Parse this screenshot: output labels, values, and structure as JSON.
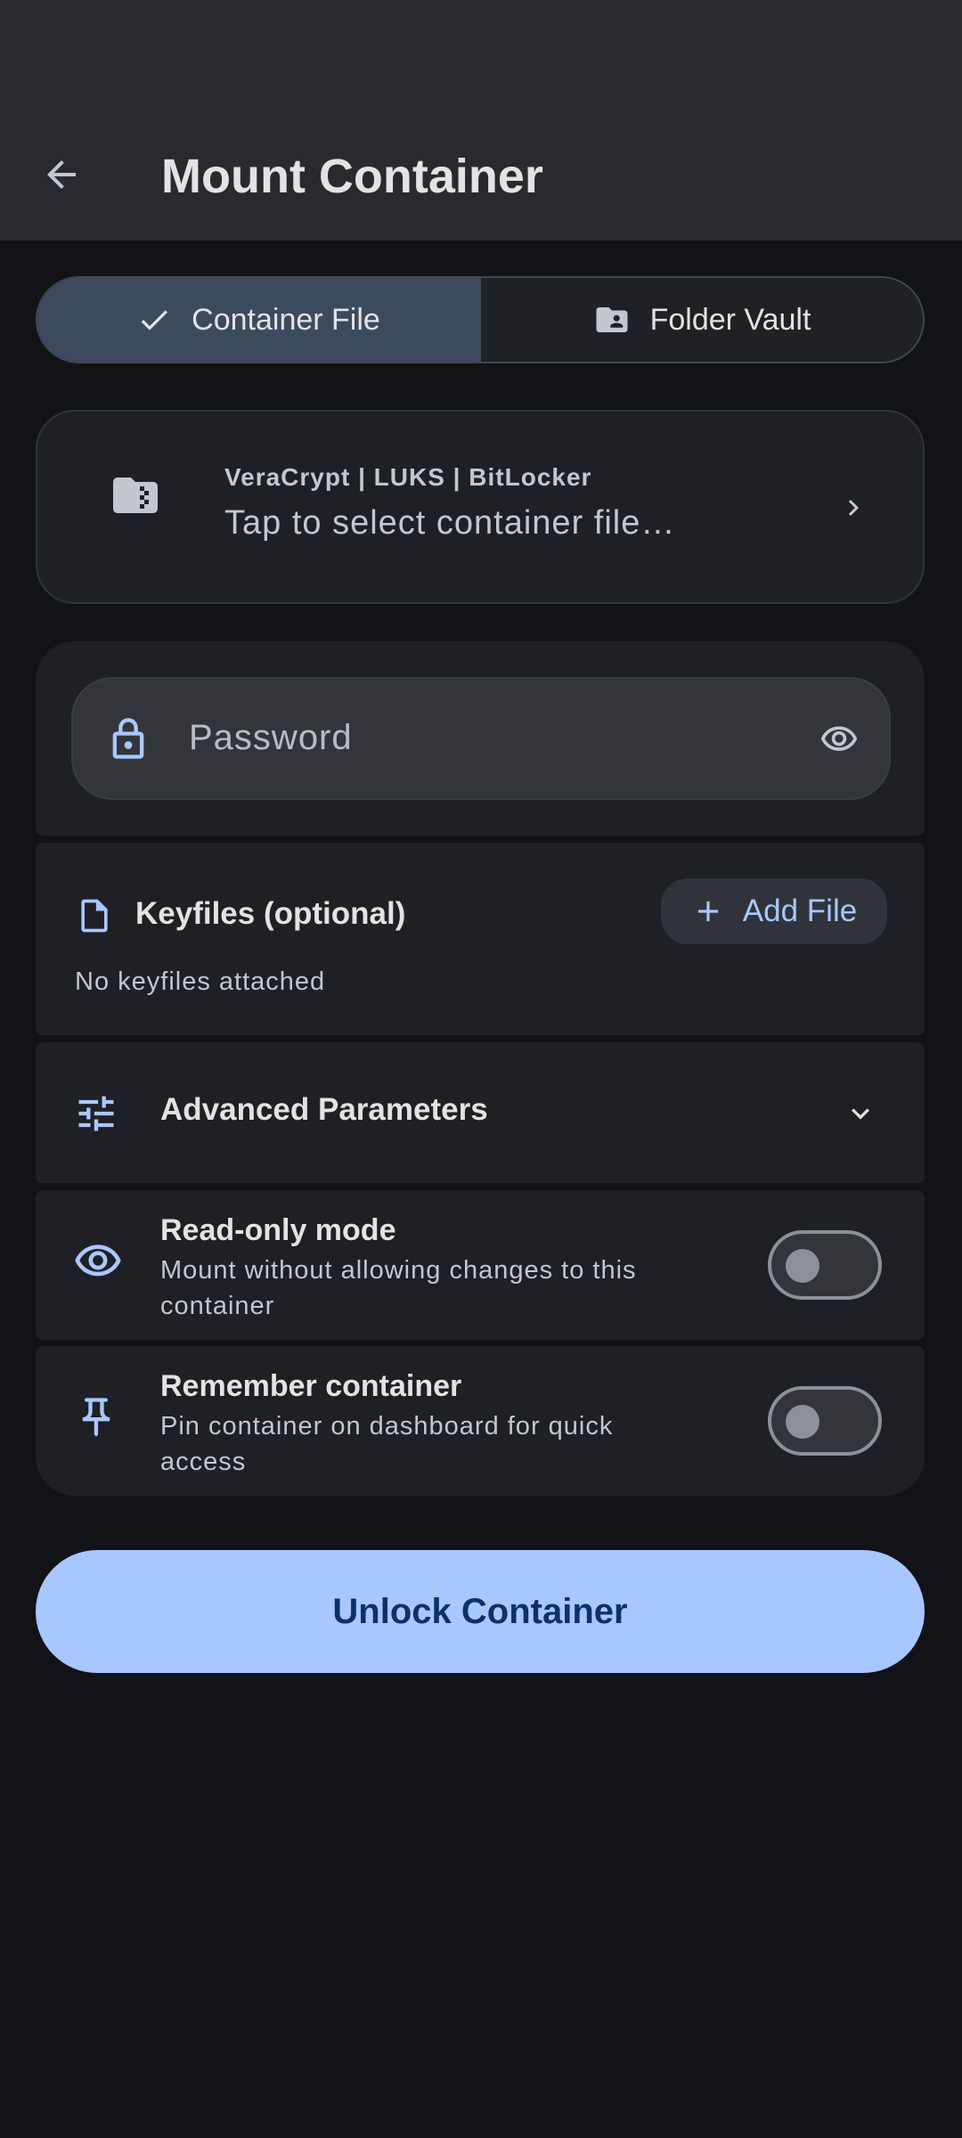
{
  "header": {
    "title": "Mount Container",
    "back_icon": "arrow-left-icon"
  },
  "mode_tabs": [
    {
      "label": "Container File",
      "icon": "check-icon",
      "selected": true
    },
    {
      "label": "Folder Vault",
      "icon": "folder-user-icon",
      "selected": false
    }
  ],
  "file_picker": {
    "formats": "VeraCrypt | LUKS | BitLocker",
    "placeholder": "Tap to select container file…",
    "icon": "zip-folder-icon"
  },
  "password": {
    "placeholder": "Password",
    "visible": false
  },
  "keyfiles": {
    "title": "Keyfiles (optional)",
    "add_label": "Add File",
    "empty_text": "No keyfiles attached"
  },
  "advanced": {
    "title": "Advanced Parameters",
    "expanded": false
  },
  "options": {
    "read_only": {
      "title": "Read-only mode",
      "description": "Mount without allowing changes to this container",
      "enabled": false
    },
    "remember": {
      "title": "Remember container",
      "description": "Pin container on dashboard for quick access",
      "enabled": false
    }
  },
  "unlock_button": {
    "label": "Unlock Container"
  },
  "colors": {
    "background": "#111318",
    "surface": "#1e2025",
    "accent": "#a9c7ff",
    "on_accent": "#0b3266",
    "selected_segment": "#3d4a5e"
  }
}
